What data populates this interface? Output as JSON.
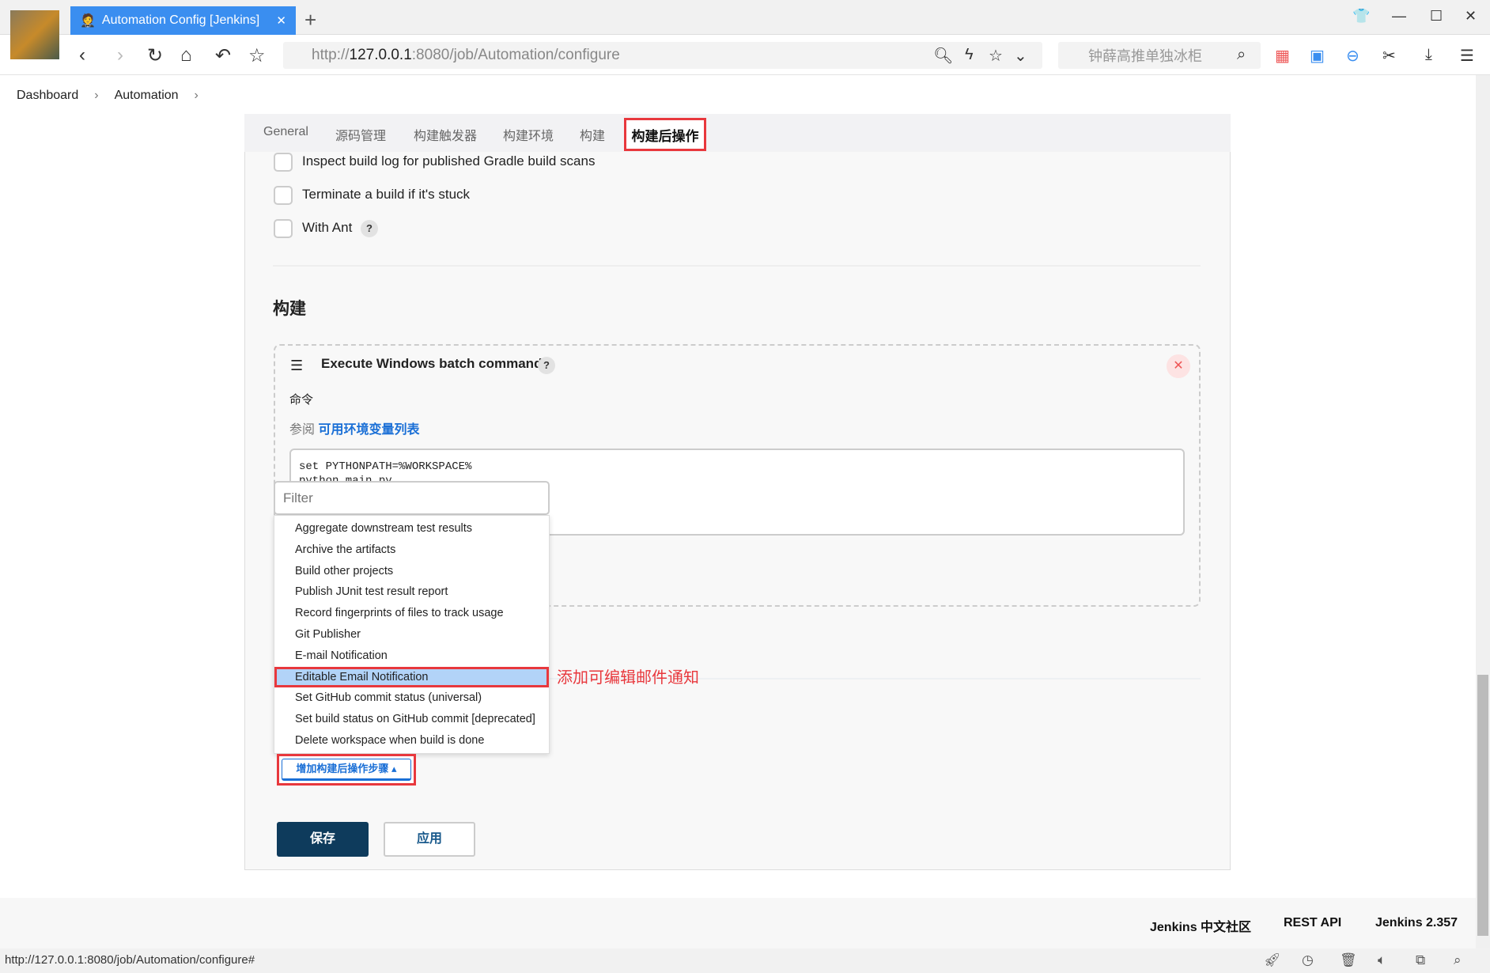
{
  "browser": {
    "tab_title": "Automation Config [Jenkins]",
    "url_host": "127.0.0.1",
    "url_prefix": "http://",
    "url_rest": ":8080/job/Automation/configure",
    "search_placeholder": "钟薛高推单独冰柜",
    "status_url": "http://127.0.0.1:8080/job/Automation/configure#"
  },
  "breadcrumb": [
    "Dashboard",
    "Automation"
  ],
  "config_tabs": [
    "General",
    "源码管理",
    "构建触发器",
    "构建环境",
    "构建",
    "构建后操作"
  ],
  "active_tab": "构建后操作",
  "checkboxes": [
    {
      "label": "Inspect build log for published Gradle build scans",
      "checked": false
    },
    {
      "label": "Terminate a build if it's stuck",
      "checked": false
    },
    {
      "label": "With Ant",
      "checked": false
    }
  ],
  "build_section": {
    "title": "构建",
    "step_title": "Execute Windows batch command",
    "command_label": "命令",
    "see_also": "参阅",
    "env_link": "可用环境变量列表",
    "command": "set PYTHONPATH=%WORKSPACE%\npython main.py"
  },
  "filter_placeholder": "Filter",
  "menu_items": [
    "Aggregate downstream test results",
    "Archive the artifacts",
    "Build other projects",
    "Publish JUnit test result report",
    "Record fingerprints of files to track usage",
    "Git Publisher",
    "E-mail Notification",
    "Editable Email Notification",
    "Set GitHub commit status (universal)",
    "Set build status on GitHub commit [deprecated]",
    "Delete workspace when build is done"
  ],
  "selected_menu_item": "Editable Email Notification",
  "annotation": "添加可编辑邮件通知",
  "add_post_build_button": "增加构建后操作步骤 ▴",
  "save_label": "保存",
  "apply_label": "应用",
  "footer": [
    "Jenkins 中文社区",
    "REST API",
    "Jenkins 2.357"
  ],
  "colors": {
    "annotation_red": "#e8383d",
    "save_bg": "#0e3b5c",
    "link_blue": "#1a6fd6",
    "tab_blue": "#3a8ef0"
  }
}
